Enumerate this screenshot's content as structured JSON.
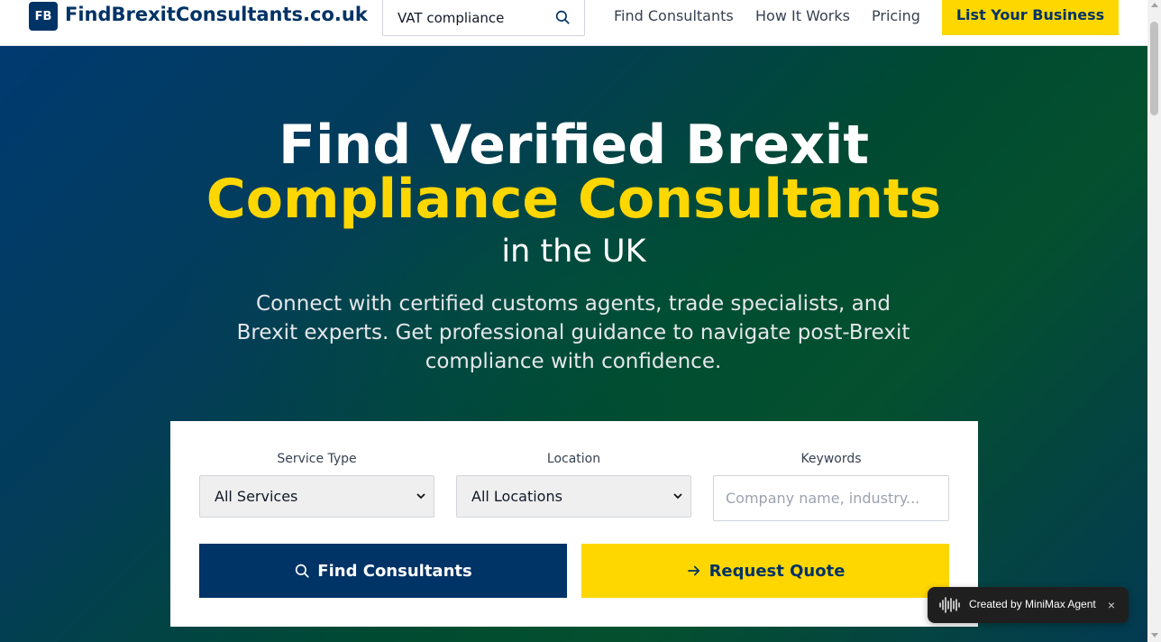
{
  "header": {
    "logo_badge": "FB",
    "logo_text": "FindBrexitConsultants.co.uk",
    "search_value": "VAT compliance",
    "nav": [
      {
        "label": "Find Consultants"
      },
      {
        "label": "How It Works"
      },
      {
        "label": "Pricing"
      }
    ],
    "cta_label": "List Your Business"
  },
  "hero": {
    "title_line1": "Find Verified Brexit",
    "title_line2": "Compliance Consultants",
    "title_line3": "in the UK",
    "subtitle": "Connect with certified customs agents, trade specialists, and Brexit experts. Get professional guidance to navigate post-Brexit compliance with confidence."
  },
  "search_card": {
    "service_label": "Service Type",
    "service_value": "All Services",
    "location_label": "Location",
    "location_value": "All Locations",
    "keywords_label": "Keywords",
    "keywords_placeholder": "Company name, industry...",
    "find_button": "Find Consultants",
    "quote_button": "Request Quote"
  },
  "agent_badge": {
    "text": "Created by MiniMax Agent",
    "close": "×"
  },
  "colors": {
    "brand_navy": "#003366",
    "brand_yellow": "#FFD700"
  },
  "icons": [
    "search-icon",
    "chevron-down-icon",
    "arrow-right-icon",
    "waveform-icon",
    "close-icon"
  ]
}
